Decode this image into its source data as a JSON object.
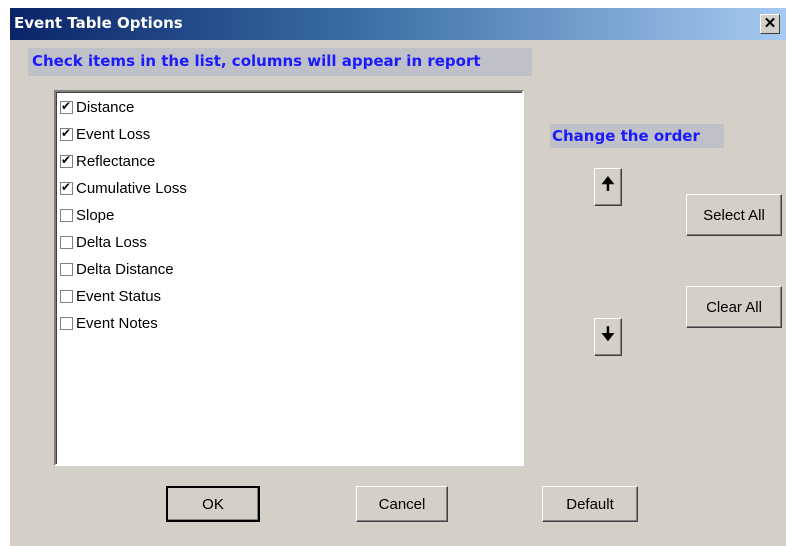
{
  "window": {
    "title": "Event Table Options",
    "close_glyph": "✕"
  },
  "instruction": "Check items in the list, columns will appear in report",
  "list": {
    "items": [
      {
        "label": "Distance",
        "checked": true
      },
      {
        "label": "Event Loss",
        "checked": true
      },
      {
        "label": "Reflectance",
        "checked": true
      },
      {
        "label": "Cumulative Loss",
        "checked": true
      },
      {
        "label": "Slope",
        "checked": false
      },
      {
        "label": "Delta Loss",
        "checked": false
      },
      {
        "label": "Delta Distance",
        "checked": false
      },
      {
        "label": "Event Status",
        "checked": false
      },
      {
        "label": "Event Notes",
        "checked": false
      }
    ]
  },
  "order": {
    "label": "Change the order",
    "up_glyph": "🠉",
    "down_glyph": "🠋"
  },
  "buttons": {
    "select_all": "Select All",
    "clear_all": "Clear All",
    "ok": "OK",
    "cancel": "Cancel",
    "default": "Default"
  }
}
